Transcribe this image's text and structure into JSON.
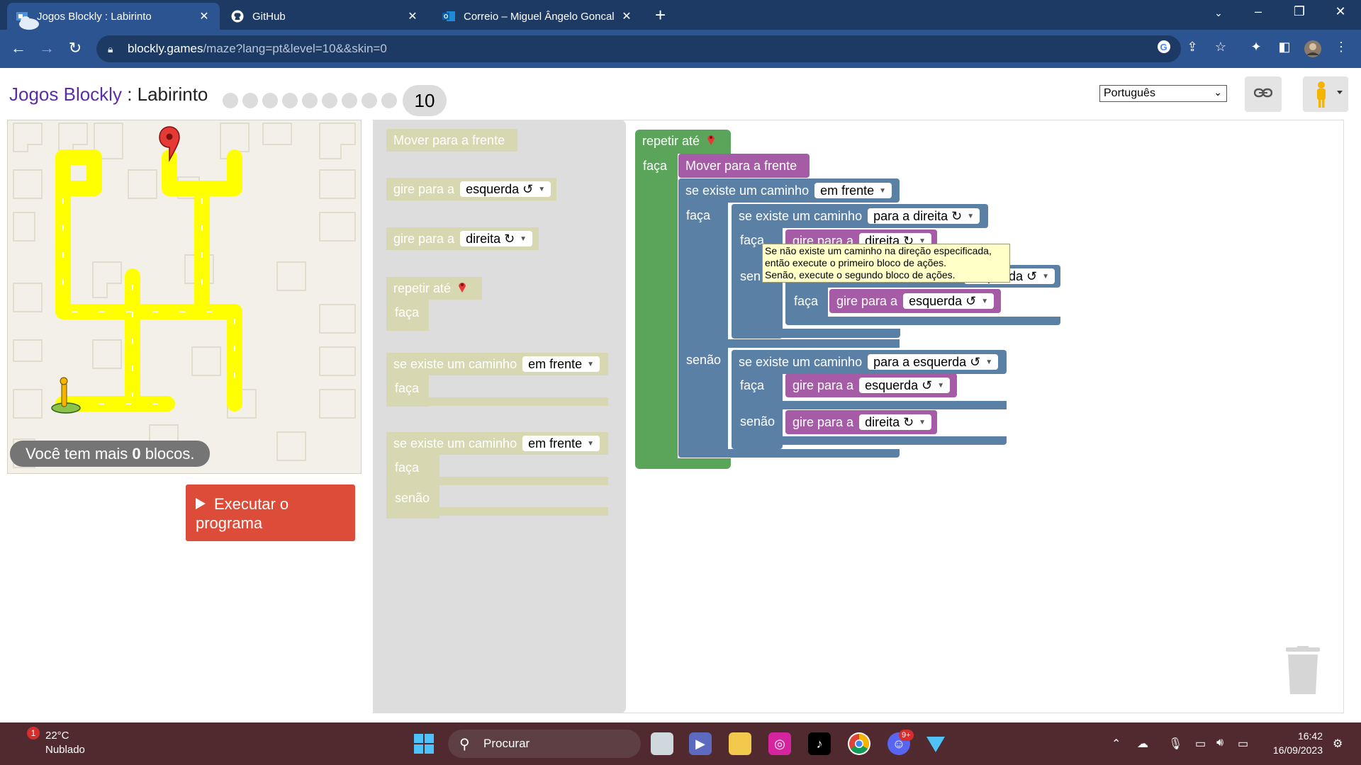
{
  "browser": {
    "tabs": [
      {
        "title": "Jogos Blockly : Labirinto",
        "active": true
      },
      {
        "title": "GitHub",
        "active": false
      },
      {
        "title": "Correio – Miguel Ângelo Goncalv",
        "active": false
      }
    ],
    "url_host": "blockly.games",
    "url_path": "/maze?lang=pt&level=10&&skin=0"
  },
  "app": {
    "title_brand": "Jogos Blockly",
    "title_sep": " : ",
    "title_page": "Labirinto",
    "current_level": "10",
    "language": "Português"
  },
  "maze": {
    "blocks_left_prefix": "Você tem mais ",
    "blocks_left_count": "0",
    "blocks_left_suffix": " blocos."
  },
  "run_button": {
    "line1": "Executar o",
    "line2": "programa"
  },
  "toolbox": {
    "move_forward": "Mover para a frente",
    "turn": "gire para a",
    "left": "esquerda ↺",
    "right": "direita ↻",
    "repeat_until": "repetir até",
    "do": "faça",
    "if_path": "se existe um caminho",
    "ahead": "em frente",
    "else": "senão"
  },
  "program": {
    "repeat_until": "repetir até",
    "do": "faça",
    "move_forward": "Mover para a frente",
    "if_path": "se existe um caminho",
    "ahead": "em frente",
    "to_right": "para a direita ↻",
    "to_left": "para a esquerda ↺",
    "turn": "gire para a",
    "right": "direita ↻",
    "left": "esquerda ↺",
    "else": "senão",
    "else_partial": "sen",
    "left_partial": "esquerda ↺"
  },
  "tooltip": {
    "line1": "Se não existe um caminho na direção especificada,",
    "line2": "então execute o primeiro bloco de ações.",
    "line3": "Senão, execute o segundo bloco de ações."
  },
  "taskbar": {
    "weather_temp": "22°C",
    "weather_desc": "Nublado",
    "weather_badge": "1",
    "search_placeholder": "Procurar",
    "discord_badge": "9+",
    "time": "16:42",
    "date": "16/09/2023"
  },
  "colors": {
    "loop_green": "#5ba55b",
    "logic_blue": "#5b80a5",
    "action_purple": "#a55ba5",
    "run_red": "#dd4b39",
    "maze_path": "#ffff00"
  }
}
